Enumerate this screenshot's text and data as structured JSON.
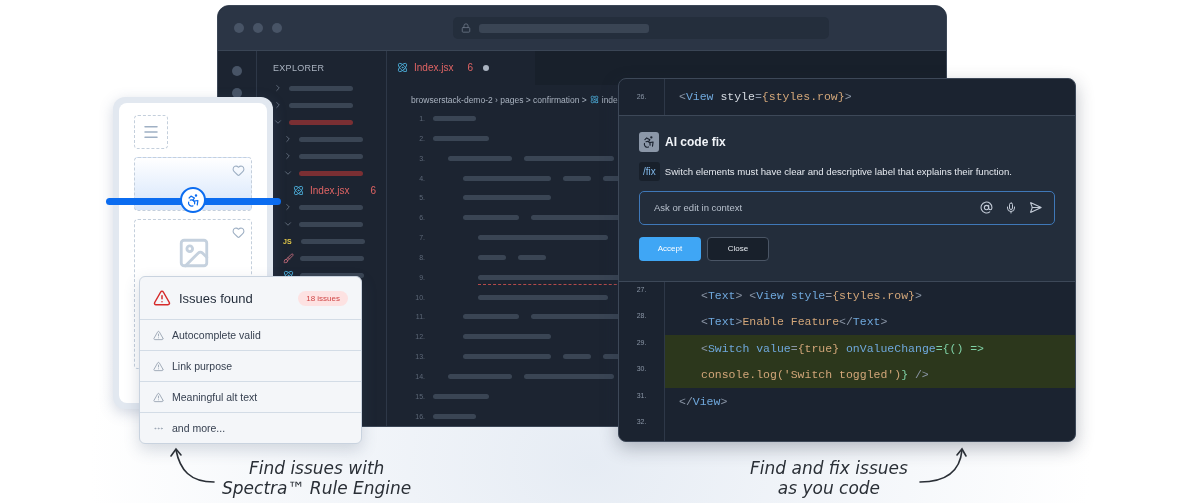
{
  "editor": {
    "explorer_title": "EXPLORER",
    "tree": [
      {
        "kind": "folder",
        "expanded": false,
        "error": false
      },
      {
        "kind": "folder",
        "expanded": false,
        "error": false
      },
      {
        "kind": "folder",
        "expanded": true,
        "error": true,
        "children": [
          {
            "kind": "folder",
            "expanded": false,
            "error": false
          },
          {
            "kind": "folder",
            "expanded": false,
            "error": false
          },
          {
            "kind": "folder",
            "expanded": true,
            "error": true,
            "children": [
              {
                "kind": "react_file",
                "name": "Index.jsx",
                "count": "6"
              }
            ]
          },
          {
            "kind": "folder",
            "expanded": false,
            "error": false
          },
          {
            "kind": "folder",
            "expanded": true,
            "error": false,
            "children": [
              {
                "kind": "js_file",
                "icon_text": "JS"
              },
              {
                "kind": "brush_file"
              },
              {
                "kind": "react_file"
              }
            ]
          }
        ]
      }
    ],
    "tab": {
      "label": "Index.jsx",
      "count": "6",
      "modified": true,
      "selected": true
    },
    "breadcrumb": "browserstack-demo-2 › pages > confirmation >",
    "breadcrumb_file": "inde",
    "line_numbers": [
      "1.",
      "2.",
      "3.",
      "4.",
      "5.",
      "6.",
      "7.",
      "8.",
      "9.",
      "10.",
      "11.",
      "12.",
      "13.",
      "14.",
      "15.",
      "16."
    ]
  },
  "issues": {
    "title": "Issues found",
    "badge": "18 issues",
    "items": [
      {
        "kind": "warning",
        "label": "Autocomplete valid"
      },
      {
        "kind": "warning",
        "label": "Link purpose"
      },
      {
        "kind": "warning",
        "label": "Meaningful alt text"
      },
      {
        "kind": "more",
        "label": "and more..."
      }
    ]
  },
  "ai_panel": {
    "code_before": [
      {
        "number": "26.",
        "highlighted": false,
        "segments": [
          {
            "kind": "punct",
            "text": "<"
          },
          {
            "kind": "tag",
            "text": "View"
          },
          {
            "kind": "attr",
            "text": " style"
          },
          {
            "kind": "punct",
            "text": "="
          },
          {
            "kind": "value",
            "text": "{styles.row}"
          },
          {
            "kind": "punct",
            "text": ">"
          }
        ]
      }
    ],
    "title": "AI code fix",
    "command": "/fix",
    "message": "Switch elements must have clear and descriptive label that explains their function.",
    "input_placeholder": "Ask or edit in context",
    "buttons": [
      {
        "kind": "primary",
        "label": "Accept"
      },
      {
        "kind": "secondary",
        "label": "Close"
      }
    ],
    "code_after": [
      {
        "number": "27.",
        "highlighted": false,
        "segments": [
          {
            "kind": "punct",
            "text": "<"
          },
          {
            "kind": "tag",
            "text": "Text"
          },
          {
            "kind": "punct",
            "text": "> <"
          },
          {
            "kind": "tag",
            "text": "View style"
          },
          {
            "kind": "punct",
            "text": "="
          },
          {
            "kind": "value",
            "text": "{styles.row}"
          },
          {
            "kind": "punct",
            "text": ">"
          }
        ]
      },
      {
        "number": "28.",
        "highlighted": false,
        "segments": [
          {
            "kind": "punct",
            "text": "<"
          },
          {
            "kind": "tag",
            "text": "Text"
          },
          {
            "kind": "punct",
            "text": ">"
          },
          {
            "kind": "value",
            "text": "Enable Feature"
          },
          {
            "kind": "punct",
            "text": "</"
          },
          {
            "kind": "tag",
            "text": "Text"
          },
          {
            "kind": "punct",
            "text": ">"
          }
        ]
      },
      {
        "number": "29.",
        "highlighted": true,
        "segments": [
          {
            "kind": "punct",
            "text": "<"
          },
          {
            "kind": "tag",
            "text": "Switch value"
          },
          {
            "kind": "punct",
            "text": "="
          },
          {
            "kind": "value",
            "text": "{true}"
          },
          {
            "kind": "tag",
            "text": " onValueChange"
          },
          {
            "kind": "arrow",
            "text": "={() =>"
          }
        ]
      },
      {
        "number": "30.",
        "highlighted": true,
        "segments": [
          {
            "kind": "value",
            "text": "console.log('Switch toggled')"
          },
          {
            "kind": "arrow",
            "text": "}"
          },
          {
            "kind": "punct",
            "text": " />"
          }
        ]
      },
      {
        "number": "31.",
        "highlighted": false,
        "segments": [
          {
            "kind": "punct",
            "text": "</"
          },
          {
            "kind": "tag",
            "text": "View"
          },
          {
            "kind": "punct",
            "text": ">"
          }
        ]
      },
      {
        "number": "32.",
        "highlighted": false
      }
    ]
  },
  "captions": [
    {
      "lines": [
        "Find issues with",
        "Spectra™ Rule Engine"
      ]
    },
    {
      "lines": [
        "Find and fix issues",
        "as you code"
      ]
    }
  ]
}
